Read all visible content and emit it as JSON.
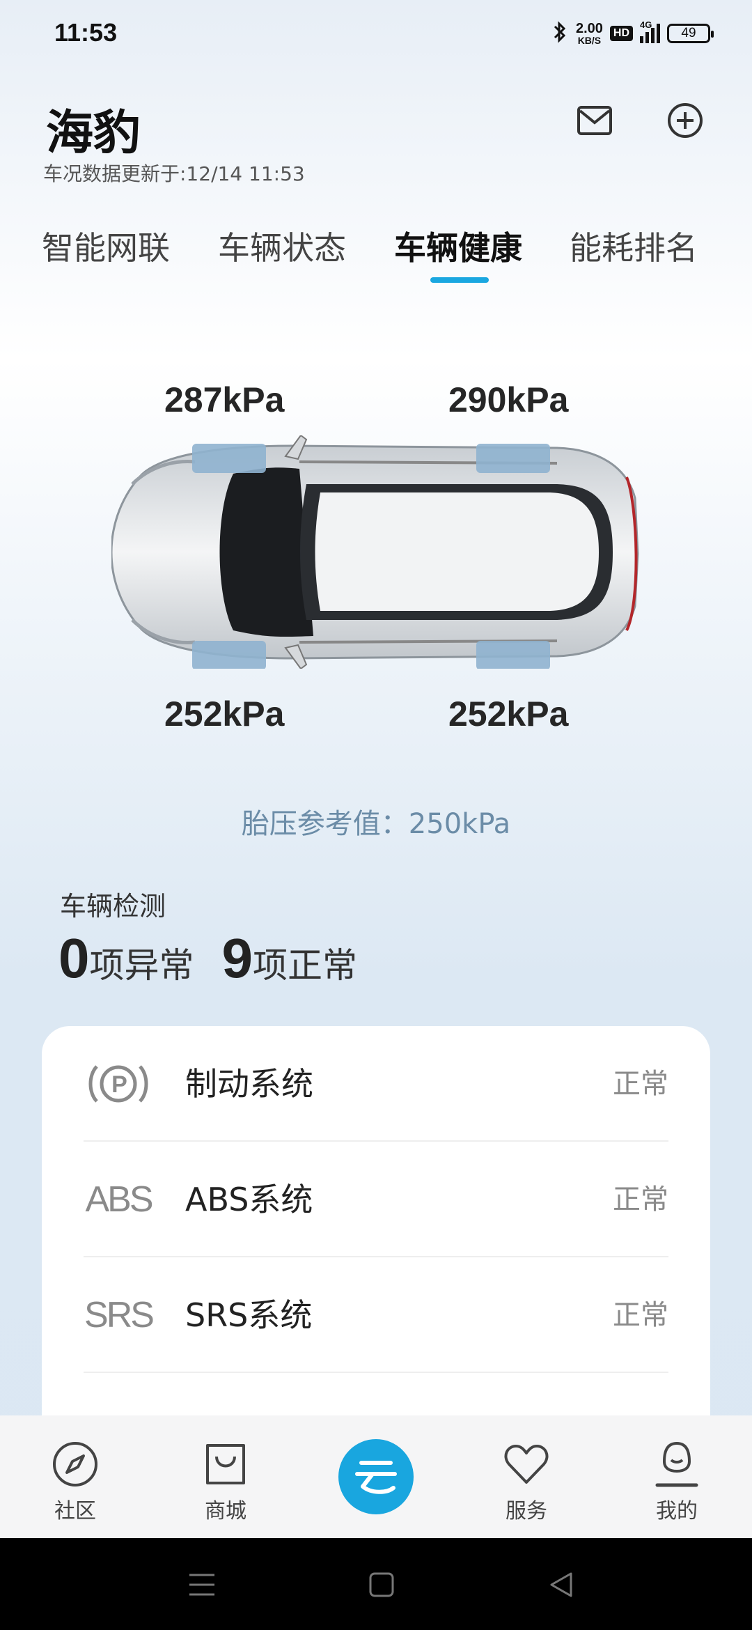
{
  "status_bar": {
    "time": "11:53",
    "net_speed_value": "2.00",
    "net_speed_unit": "KB/S",
    "hd": "HD",
    "network": "4G",
    "battery": "49"
  },
  "header": {
    "title": "海豹",
    "update_text": "车况数据更新于:12/14 11:53"
  },
  "tabs": [
    {
      "label": "智能网联",
      "active": false
    },
    {
      "label": "车辆状态",
      "active": false
    },
    {
      "label": "车辆健康",
      "active": true
    },
    {
      "label": "能耗排名",
      "active": false
    }
  ],
  "tire_pressure": {
    "front_left": "287kPa",
    "front_right": "290kPa",
    "rear_left": "252kPa",
    "rear_right": "252kPa",
    "reference": "胎压参考值：250kPa"
  },
  "detection": {
    "title": "车辆检测",
    "abnormal_count": "0",
    "abnormal_label": "项异常",
    "normal_count": "9",
    "normal_label": "项正常",
    "items": [
      {
        "icon": "parking-brake-icon",
        "icon_text": "P",
        "label": "制动系统",
        "status": "正常"
      },
      {
        "icon": "abs-icon",
        "icon_text": "ABS",
        "label": "ABS系统",
        "status": "正常"
      },
      {
        "icon": "srs-icon",
        "icon_text": "SRS",
        "label": "SRS系统",
        "status": "正常"
      }
    ]
  },
  "bottom_nav": {
    "items": [
      {
        "label": "社区",
        "icon": "compass-icon"
      },
      {
        "label": "商城",
        "icon": "shopping-bag-icon"
      },
      {
        "label": "",
        "icon": "cloud-logo-icon"
      },
      {
        "label": "服务",
        "icon": "heart-icon"
      },
      {
        "label": "我的",
        "icon": "profile-icon"
      }
    ]
  },
  "colors": {
    "accent": "#1aa7e0",
    "tire_indicator": "#8fb2cf",
    "reference_text": "#6b8ca7"
  }
}
